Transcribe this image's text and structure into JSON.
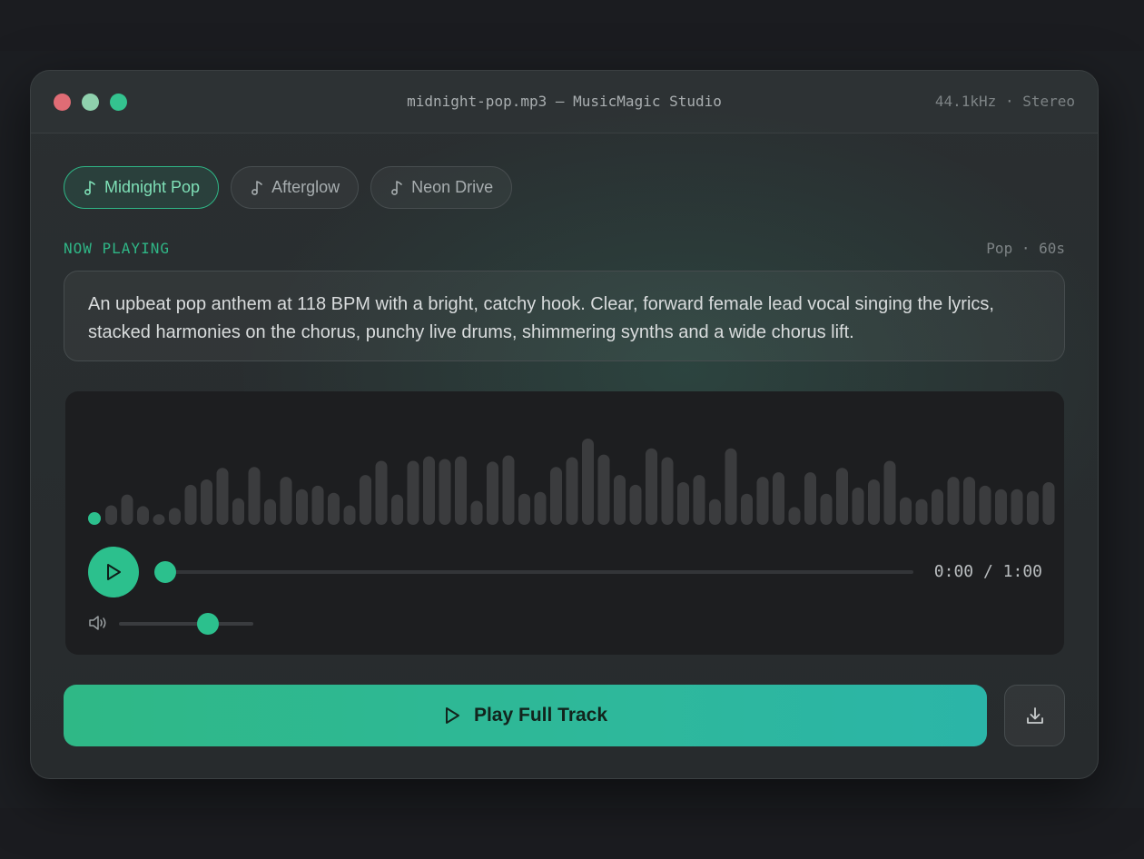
{
  "window": {
    "title": "midnight-pop.mp3 — MusicMagic Studio",
    "audio_info": "44.1kHz · Stereo"
  },
  "tabs": [
    {
      "label": "Midnight Pop",
      "icon": "music-note-icon",
      "active": true
    },
    {
      "label": "Afterglow",
      "icon": "music-note-icon",
      "active": false
    },
    {
      "label": "Neon Drive",
      "icon": "music-note-icon",
      "active": false
    }
  ],
  "now_playing": {
    "label": "NOW PLAYING",
    "meta": "Pop · 60s",
    "prompt": "An upbeat pop anthem at 118 BPM with a bright, catchy hook. Clear, forward female lead vocal singing the lyrics, stacked harmonies on the chorus, punchy live drums, shimmering synths and a wide chorus lift."
  },
  "player": {
    "time": "0:00 / 1:00",
    "progress": 0,
    "volume": 0.67,
    "waveform_levels": [
      0.22,
      0.34,
      0.21,
      0.12,
      0.19,
      0.45,
      0.51,
      0.64,
      0.3,
      0.65,
      0.29,
      0.54,
      0.4,
      0.44,
      0.36,
      0.22,
      0.56,
      0.72,
      0.34,
      0.72,
      0.77,
      0.74,
      0.77,
      0.27,
      0.71,
      0.78,
      0.35,
      0.37,
      0.65,
      0.76,
      0.97,
      0.79,
      0.56,
      0.45,
      0.86,
      0.76,
      0.48,
      0.56,
      0.29,
      0.86,
      0.35,
      0.54,
      0.59,
      0.2,
      0.59,
      0.35,
      0.64,
      0.42,
      0.51,
      0.72,
      0.31,
      0.29,
      0.4,
      0.54,
      0.54,
      0.44,
      0.4,
      0.4,
      0.38,
      0.48
    ]
  },
  "actions": {
    "play_full_label": "Play Full Track"
  },
  "colors": {
    "accent": "#2cc08d",
    "waveform_bar": "#3b3c3e"
  }
}
